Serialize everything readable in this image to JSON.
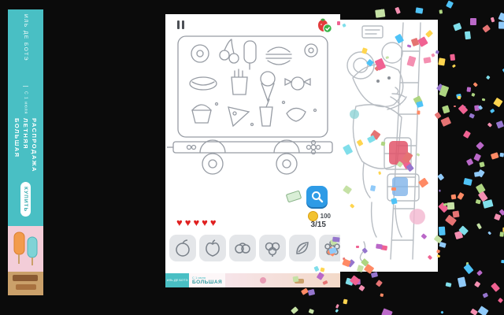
{
  "colors": {
    "accent_teal": "#49bfc4",
    "heart_red": "#e02020",
    "hint_blue": "#2e9be6",
    "coin_yellow": "#f2c230"
  },
  "banner": {
    "brand": "ИЛЬ ДЕ БОТЭ",
    "subtitle": "С 1 июля",
    "title_lines": [
      "БОЛЬШАЯ",
      "ЛЕТНЯЯ",
      "РАСПРОДАЖА"
    ],
    "cta": "КУПИТЬ"
  },
  "game": {
    "heart_icon": "♥",
    "lives": 5,
    "progress": "3/15",
    "coins": "100",
    "items": [
      {
        "name": "peach"
      },
      {
        "name": "apple"
      },
      {
        "name": "pretzel"
      },
      {
        "name": "clover"
      },
      {
        "name": "leaf"
      },
      {
        "name": "flower"
      }
    ]
  },
  "footer_banner": {
    "brand": "ИЛЬ ДЕ БОТЭ",
    "subtitle": "С 1 июля",
    "title": "БОЛЬШАЯ"
  },
  "confetti_palette": [
    "#f06292",
    "#ba68c8",
    "#4fc3f7",
    "#aed581",
    "#ffd54f",
    "#ff8a65",
    "#90caf9",
    "#f48fb1",
    "#80deea",
    "#c5e1a5",
    "#e57373",
    "#9575cd"
  ]
}
